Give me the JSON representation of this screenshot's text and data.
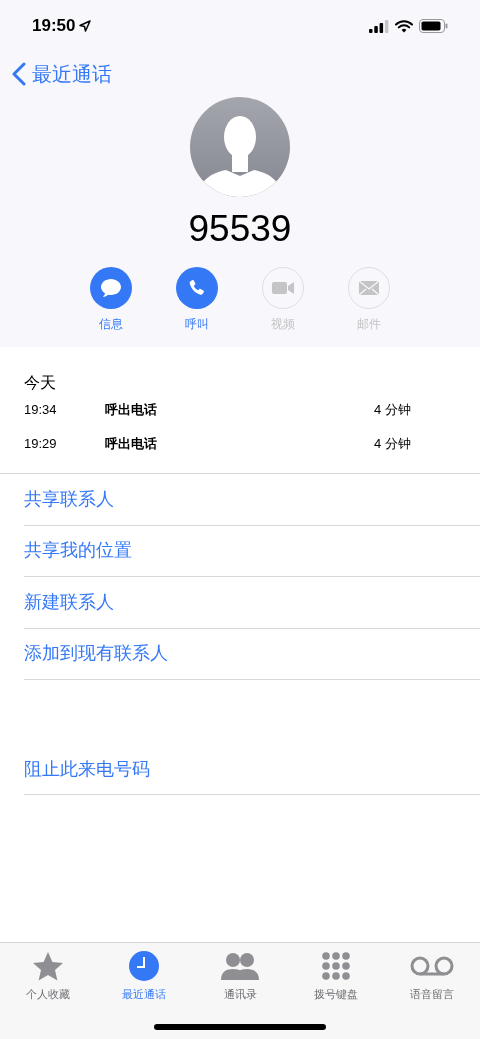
{
  "status_bar": {
    "time": "19:50"
  },
  "nav": {
    "back": "最近通话"
  },
  "contact": {
    "number": "95539"
  },
  "actions": [
    {
      "kind": "message",
      "label": "信息",
      "disabled": false
    },
    {
      "kind": "call",
      "label": "呼叫",
      "disabled": false
    },
    {
      "kind": "video",
      "label": "视频",
      "disabled": true
    },
    {
      "kind": "mail",
      "label": "邮件",
      "disabled": true
    }
  ],
  "calls": {
    "heading": "今天",
    "rows": [
      {
        "time": "19:34",
        "type": "呼出电话",
        "duration": "4 分钟"
      },
      {
        "time": "19:29",
        "type": "呼出电话",
        "duration": "4 分钟"
      }
    ]
  },
  "options": [
    "共享联系人",
    "共享我的位置",
    "新建联系人",
    "添加到现有联系人"
  ],
  "block": "阻止此来电号码",
  "tabs": [
    {
      "kind": "favorites",
      "label": "个人收藏",
      "selected": false
    },
    {
      "kind": "recents",
      "label": "最近通话",
      "selected": true
    },
    {
      "kind": "contacts",
      "label": "通讯录",
      "selected": false
    },
    {
      "kind": "keypad",
      "label": "拨号键盘",
      "selected": false
    },
    {
      "kind": "voicemail",
      "label": "语音留言",
      "selected": false
    }
  ]
}
